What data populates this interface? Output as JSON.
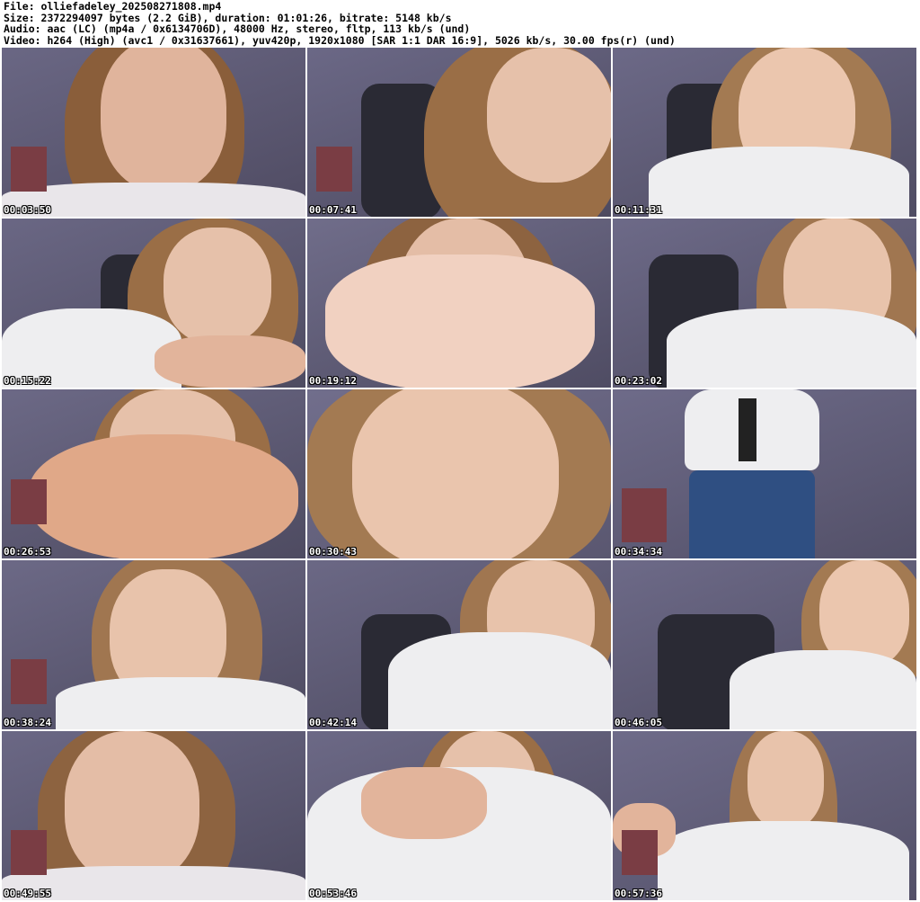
{
  "header": {
    "file": "File: olliefadeley_202508271808.mp4",
    "size": "Size: 2372294097 bytes (2.2 GiB), duration: 01:01:26, bitrate: 5148 kb/s",
    "audio": "Audio: aac (LC) (mp4a / 0x6134706D), 48000 Hz, stereo, fltp, 113 kb/s (und)",
    "video": "Video: h264 (High) (avc1 / 0x31637661), yuv420p, 1920x1080 [SAR 1:1 DAR 16:9], 5026 kb/s, 30.00 fps(r) (und)"
  },
  "thumbnails": [
    {
      "timestamp": "00:03:50"
    },
    {
      "timestamp": "00:07:41"
    },
    {
      "timestamp": "00:11:31"
    },
    {
      "timestamp": "00:15:22"
    },
    {
      "timestamp": "00:19:12"
    },
    {
      "timestamp": "00:23:02"
    },
    {
      "timestamp": "00:26:53"
    },
    {
      "timestamp": "00:30:43"
    },
    {
      "timestamp": "00:34:34"
    },
    {
      "timestamp": "00:38:24"
    },
    {
      "timestamp": "00:42:14"
    },
    {
      "timestamp": "00:46:05"
    },
    {
      "timestamp": "00:49:55"
    },
    {
      "timestamp": "00:53:46"
    },
    {
      "timestamp": "00:57:36"
    }
  ]
}
